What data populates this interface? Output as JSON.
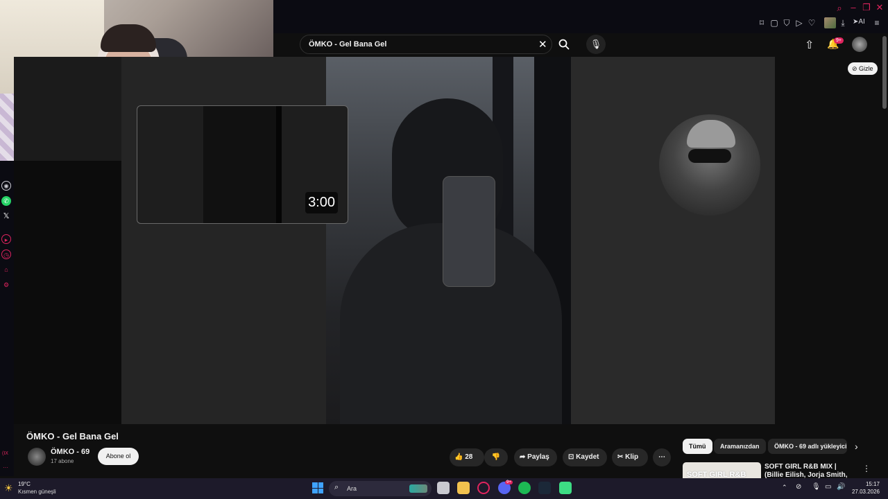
{
  "search": {
    "query": "ÖMKO - Gel Bana Gel"
  },
  "preview": {
    "duration": "3:00"
  },
  "overlay": {
    "hide_label": "Gizle"
  },
  "notifications": {
    "badge": "9+"
  },
  "ai_label": "AI",
  "video": {
    "title": "ÖMKO - Gel Bana Gel",
    "channel_name": "ÖMKO - 69",
    "subscribers": "17 abone",
    "subscribe_label": "Abone ol",
    "likes": "28",
    "share_label": "Paylaş",
    "save_label": "Kaydet",
    "clip_label": "Klip"
  },
  "chips": [
    "Tümü",
    "Aramanızdan",
    "ÖMKO - 69 adlı yükleyici"
  ],
  "recommendation": {
    "title": "SOFT GIRL R&B MIX | (Billie Eilish, Jorja Smith, Snoh",
    "thumb_text": "SOFT GIRL R&B"
  },
  "taskbar": {
    "weather_temp": "19°C",
    "weather_desc": "Kısmen güneşli",
    "search_placeholder": "Ara",
    "time": "15:17",
    "date": "27.03.2026",
    "discord_badge": "9+"
  },
  "sidebar_badge": "(IX",
  "colors": {
    "accent": "#e0245e",
    "youtube_bg": "#0f0f0f",
    "taskbar": "#1d1a2a"
  }
}
